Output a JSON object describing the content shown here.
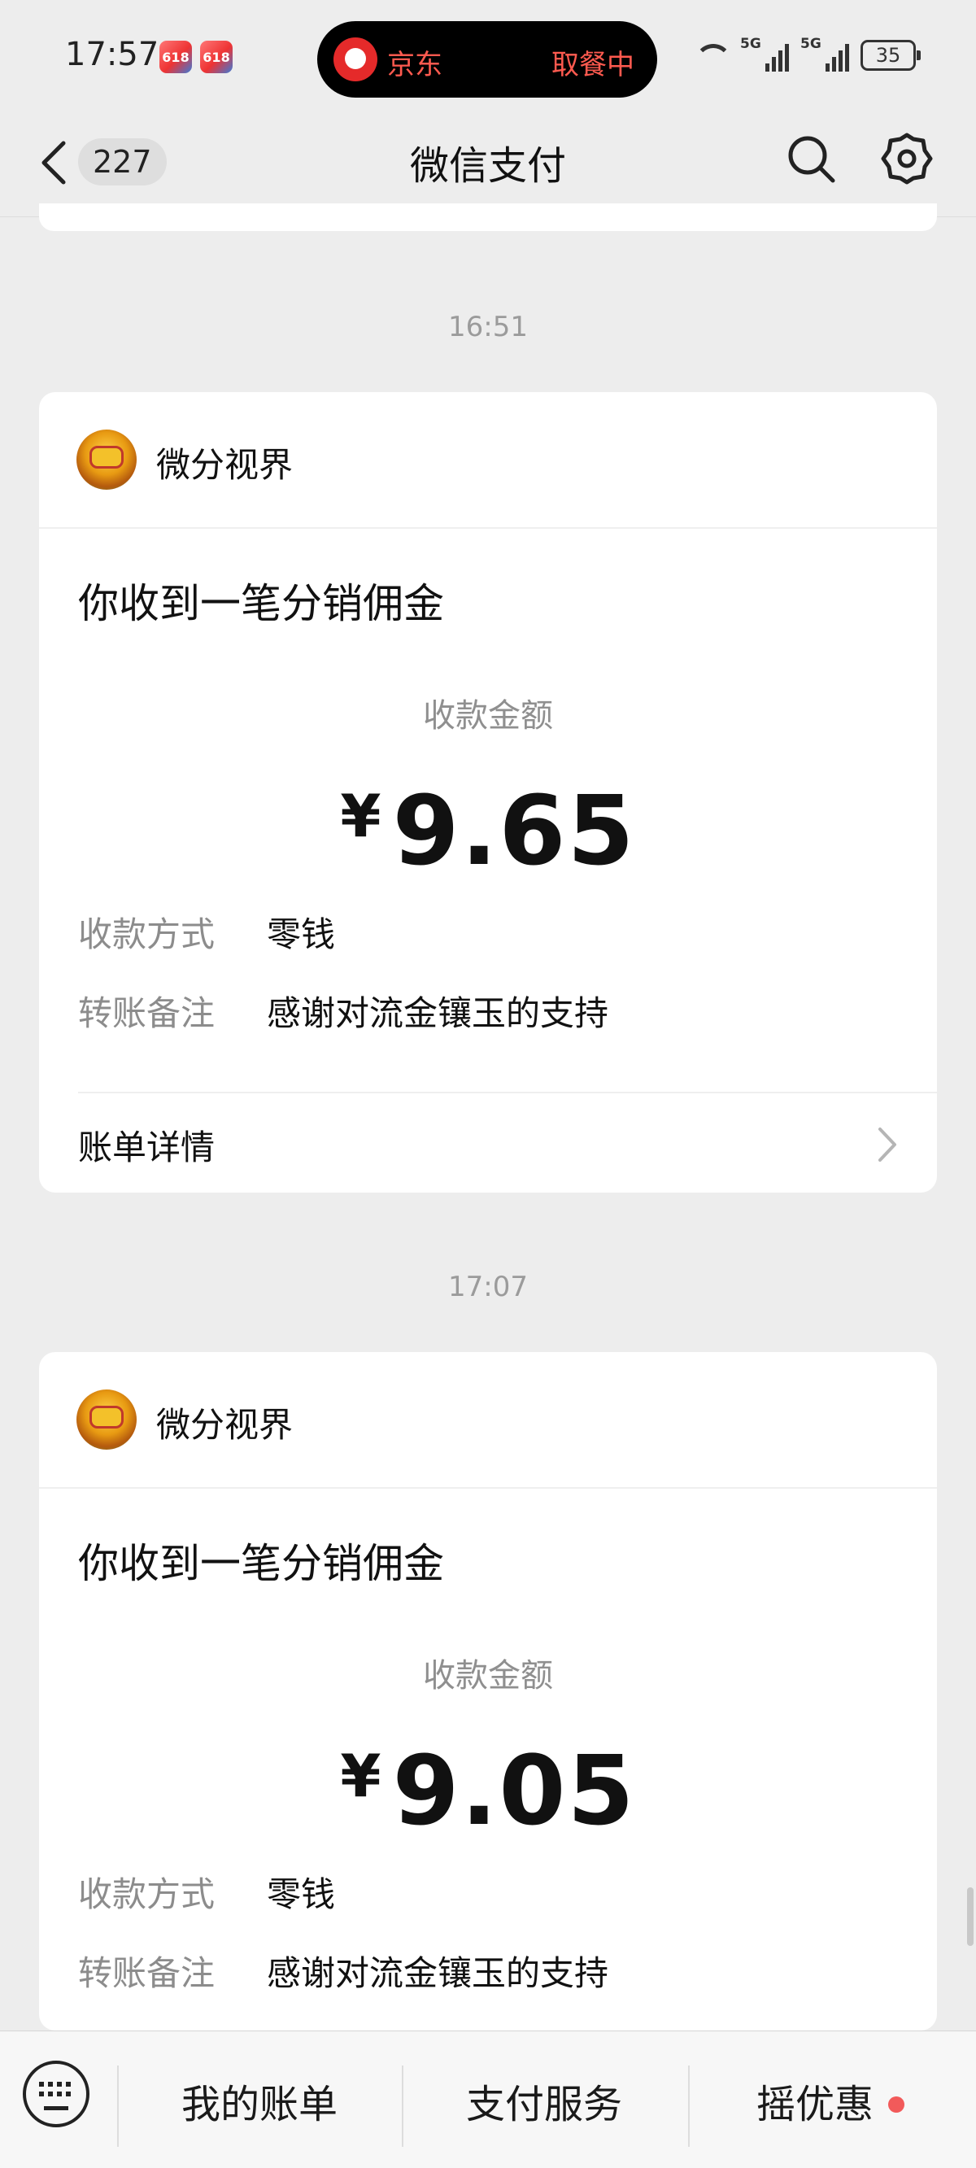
{
  "status_bar": {
    "time": "17:57",
    "app_icon_label": "618",
    "island_app": "京东",
    "island_status": "取餐中",
    "network_1": "5G",
    "network_2": "5G",
    "battery": "35"
  },
  "header": {
    "unread_count": "227",
    "title": "微信支付"
  },
  "messages": [
    {
      "time": "16:51",
      "sender": "微分视界",
      "headline": "你收到一笔分销佣金",
      "amount_label": "收款金额",
      "currency": "¥",
      "amount": "9.65",
      "method_key": "收款方式",
      "method_value": "零钱",
      "note_key": "转账备注",
      "note_value": "感谢对流金镶玉的支持",
      "detail_label": "账单详情"
    },
    {
      "time": "17:07",
      "sender": "微分视界",
      "headline": "你收到一笔分销佣金",
      "amount_label": "收款金额",
      "currency": "¥",
      "amount": "9.05",
      "method_key": "收款方式",
      "method_value": "零钱",
      "note_key": "转账备注",
      "note_value": "感谢对流金镶玉的支持"
    }
  ],
  "bottom_bar": {
    "tab1": "我的账单",
    "tab2": "支付服务",
    "tab3": "摇优惠"
  },
  "colors": {
    "background": "#ededed",
    "card": "#ffffff",
    "island_text": "#ff5a4f",
    "red_dot": "#f25a5a"
  }
}
